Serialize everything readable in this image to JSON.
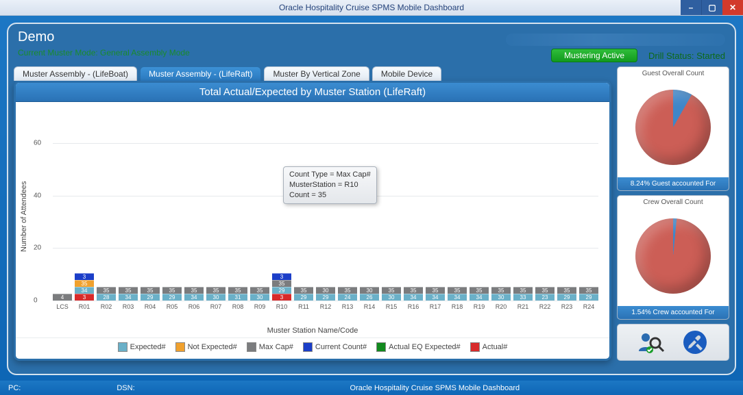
{
  "window": {
    "title": "Oracle Hospitality Cruise SPMS Mobile Dashboard"
  },
  "header": {
    "title": "Demo",
    "mode_line": "Current Muster Mode: General Assembly Mode",
    "mustering_btn": "Mustering Active",
    "drill_status": "Drill Status: Started"
  },
  "tabs": {
    "items": [
      {
        "label": "Muster Assembly - (LifeBoat)",
        "active": false
      },
      {
        "label": "Muster Assembly - (LifeRaft)",
        "active": true
      },
      {
        "label": "Muster By Vertical Zone",
        "active": false
      },
      {
        "label": "Mobile Device",
        "active": false
      }
    ]
  },
  "chart": {
    "title": "Total Actual/Expected by Muster Station (LifeRaft)",
    "ylabel": "Number of Attendees",
    "xlabel": "Muster Station Name/Code",
    "legend": {
      "expected": "Expected#",
      "not_expected": "Not Expected#",
      "max_cap": "Max Cap#",
      "current": "Current Count#",
      "actual_eq": "Actual EQ Expected#",
      "actual": "Actual#"
    }
  },
  "tooltip": {
    "line1": "Count Type = Max Cap#",
    "line2": "MusterStation = R10",
    "line3": "Count = 35"
  },
  "pies": {
    "guest": {
      "title": "Guest Overall Count",
      "footer": "8.24% Guest accounted For",
      "pct": 8.24
    },
    "crew": {
      "title": "Crew Overall Count",
      "footer": "1.54% Crew accounted For",
      "pct": 1.54
    }
  },
  "footer": {
    "pc": "PC:",
    "dsn": "DSN:",
    "app": "Oracle Hospitality Cruise SPMS Mobile Dashboard"
  },
  "chart_data": {
    "type": "bar",
    "title": "Total Actual/Expected by Muster Station (LifeRaft)",
    "xlabel": "Muster Station Name/Code",
    "ylabel": "Number of Attendees",
    "ylim": [
      0,
      72
    ],
    "yticks": [
      0,
      20,
      40,
      60
    ],
    "categories": [
      "LCS",
      "R01",
      "R02",
      "R03",
      "R04",
      "R05",
      "R06",
      "R07",
      "R08",
      "R09",
      "R10",
      "R11",
      "R12",
      "R13",
      "R14",
      "R15",
      "R16",
      "R17",
      "R18",
      "R19",
      "R20",
      "R21",
      "R22",
      "R23",
      "R24"
    ],
    "stacks_order": [
      "actual",
      "expected",
      "not_expected",
      "max_cap",
      "current"
    ],
    "series": [
      {
        "name": "Expected#",
        "key": "expected",
        "color": "#6ab0c8",
        "values": [
          0,
          34,
          28,
          34,
          29,
          29,
          34,
          30,
          31,
          30,
          29,
          29,
          29,
          24,
          26,
          30,
          34,
          34,
          34,
          34,
          30,
          33,
          23,
          29,
          29
        ]
      },
      {
        "name": "Not Expected#",
        "key": "not_expected",
        "color": "#f0a12e",
        "values": [
          0,
          35,
          0,
          0,
          0,
          0,
          0,
          0,
          0,
          0,
          0,
          0,
          0,
          0,
          0,
          0,
          0,
          0,
          0,
          0,
          0,
          0,
          0,
          0,
          0
        ]
      },
      {
        "name": "Max Cap#",
        "key": "max_cap",
        "color": "#7b7c7e",
        "values": [
          4,
          0,
          35,
          35,
          35,
          35,
          35,
          35,
          35,
          35,
          35,
          35,
          30,
          35,
          30,
          35,
          35,
          35,
          35,
          35,
          35,
          35,
          35,
          35,
          35
        ]
      },
      {
        "name": "Current Count#",
        "key": "current",
        "color": "#1b3ec8",
        "values": [
          0,
          3,
          0,
          0,
          0,
          0,
          0,
          0,
          0,
          0,
          3,
          0,
          0,
          0,
          0,
          0,
          0,
          0,
          0,
          0,
          0,
          0,
          0,
          0,
          0
        ]
      },
      {
        "name": "Actual EQ Expected#",
        "key": "actual_eq",
        "color": "#128a1e",
        "values": [
          0,
          0,
          0,
          0,
          0,
          0,
          0,
          0,
          0,
          0,
          0,
          0,
          0,
          0,
          0,
          0,
          0,
          0,
          0,
          0,
          0,
          0,
          0,
          0,
          0
        ]
      },
      {
        "name": "Actual#",
        "key": "actual",
        "color": "#d82a2a",
        "values": [
          0,
          3,
          0,
          0,
          0,
          0,
          0,
          0,
          0,
          0,
          3,
          0,
          0,
          0,
          0,
          0,
          0,
          0,
          0,
          0,
          0,
          0,
          0,
          0,
          0
        ]
      }
    ]
  }
}
